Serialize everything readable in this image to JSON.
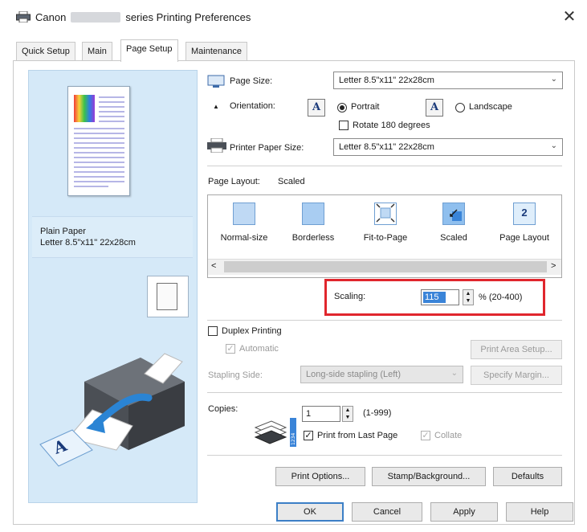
{
  "window": {
    "title_prefix": "Canon",
    "title_suffix": "series Printing Preferences",
    "close_glyph": "✕"
  },
  "tabs": [
    {
      "label": "Quick Setup",
      "active": false
    },
    {
      "label": "Main",
      "active": false
    },
    {
      "label": "Page Setup",
      "active": true
    },
    {
      "label": "Maintenance",
      "active": false
    }
  ],
  "preview": {
    "media_type": "Plain Paper",
    "paper_size": "Letter 8.5\"x11\" 22x28cm"
  },
  "page_size": {
    "label": "Page Size:",
    "value": "Letter 8.5\"x11\" 22x28cm"
  },
  "orientation": {
    "label": "Orientation:",
    "portrait": "Portrait",
    "landscape": "Landscape",
    "selected": "portrait",
    "icon_letter": "A"
  },
  "rotate": {
    "label": "Rotate 180 degrees",
    "checked": false
  },
  "printer_paper_size": {
    "label": "Printer Paper Size:",
    "value": "Letter 8.5\"x11\" 22x28cm"
  },
  "page_layout": {
    "label": "Page Layout:",
    "current": "Scaled",
    "options": [
      "Normal-size",
      "Borderless",
      "Fit-to-Page",
      "Scaled",
      "Page Layout"
    ],
    "page_layout_number": "2",
    "scroll_left": "<",
    "scroll_right": ">"
  },
  "scaling": {
    "label": "Scaling:",
    "value": "115",
    "range": "% (20-400)"
  },
  "duplex": {
    "label": "Duplex Printing",
    "checked": false,
    "automatic_label": "Automatic",
    "automatic_checked": true,
    "print_area_button": "Print Area Setup...",
    "stapling_label": "Stapling Side:",
    "stapling_value": "Long-side stapling (Left)",
    "specify_margin_button": "Specify Margin..."
  },
  "copies": {
    "label": "Copies:",
    "value": "1",
    "range": "(1-999)",
    "print_from_last_label": "Print from Last Page",
    "print_from_last_checked": true,
    "collate_label": "Collate",
    "collate_checked": true
  },
  "buttons": {
    "print_options": "Print Options...",
    "stamp_background": "Stamp/Background...",
    "defaults": "Defaults",
    "ok": "OK",
    "cancel": "Cancel",
    "apply": "Apply",
    "help": "Help"
  },
  "colors": {
    "accent": "#3a84d8",
    "highlight_border": "#e0262d",
    "preview_bg": "#d5e9f8"
  }
}
